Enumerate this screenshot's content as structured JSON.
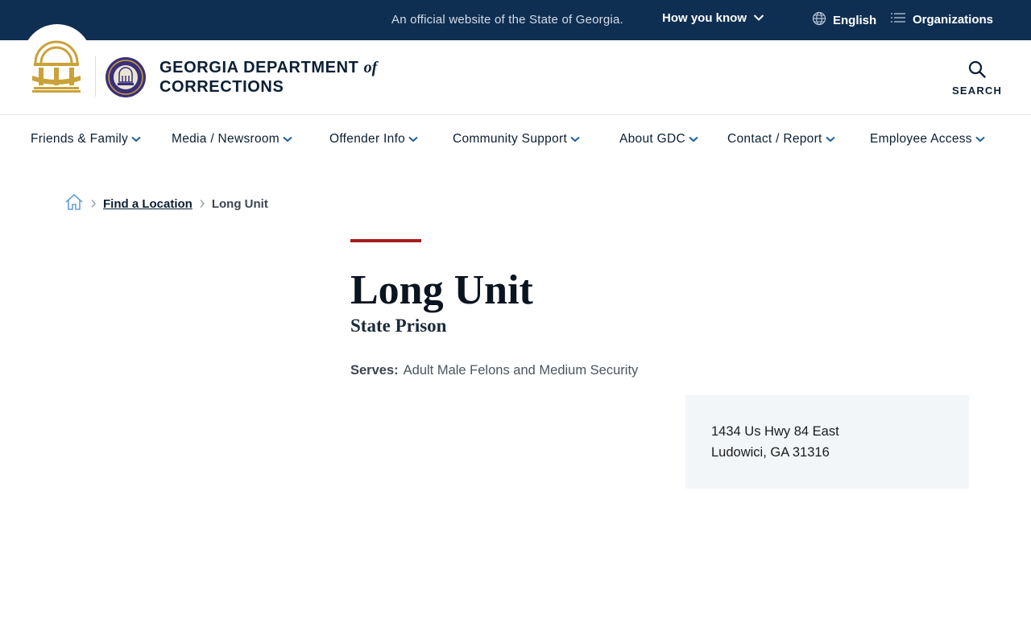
{
  "banner": {
    "official_text": "An official website of the State of Georgia.",
    "how_you_know": "How you know",
    "language": "English",
    "organizations": "Organizations"
  },
  "header": {
    "brand_line1": "GEORGIA DEPARTMENT",
    "brand_of": "of",
    "brand_line2": "CORRECTIONS",
    "search_label": "SEARCH"
  },
  "nav": {
    "items": [
      {
        "label": "Friends & Family"
      },
      {
        "label": "Media / Newsroom"
      },
      {
        "label": "Offender Info"
      },
      {
        "label": "Community Support"
      },
      {
        "label": "About GDC"
      },
      {
        "label": "Contact / Report"
      },
      {
        "label": "Employee Access"
      }
    ]
  },
  "breadcrumb": {
    "home_icon": "home-icon",
    "items": [
      {
        "label": "Find a Location"
      },
      {
        "label": "Long Unit"
      }
    ]
  },
  "page": {
    "title": "Long Unit",
    "subtitle": "State Prison",
    "serves_label": "Serves:",
    "serves_value": "Adult Male Felons and Medium Security"
  },
  "address": {
    "line1": "1434 Us Hwy 84 East",
    "line2": "Ludowici, GA 31316"
  },
  "colors": {
    "banner_bg": "#0f2f52",
    "accent_red": "#a51c1c",
    "seal_gold": "#c9a23a",
    "seal_purple": "#3a2f7a",
    "nav_chevron": "#1f5f9a",
    "address_bg": "#f3f6f9"
  }
}
